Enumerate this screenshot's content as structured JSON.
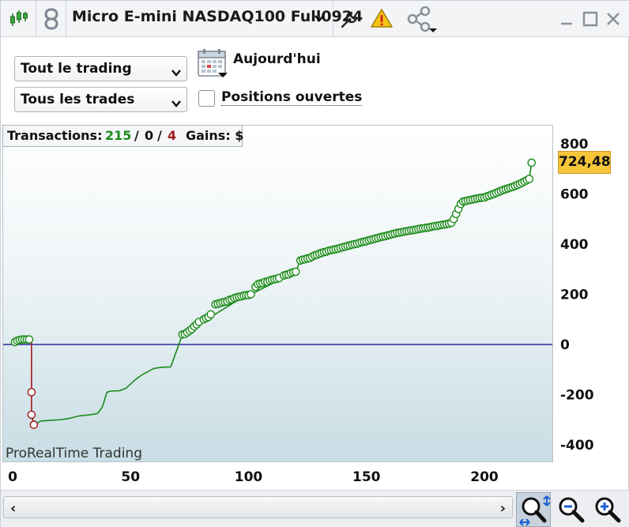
{
  "toolbar": {
    "instrument": "Micro E-mini NASDAQ100 Full0924"
  },
  "filters": {
    "scope_select": "Tout le trading",
    "trades_select": "Tous les trades",
    "date_label": "Aujourd'hui",
    "open_positions_label": "Positions ouvertes",
    "open_positions_checked": false
  },
  "stats": {
    "transactions_label": "Transactions:",
    "winning": "215",
    "separator1": "/",
    "neutral": "0",
    "separator2": "/",
    "losing": "4",
    "gains_label": "Gains: $"
  },
  "watermark": "ProRealTime Trading",
  "last_value": "724,48",
  "colors": {
    "win": "#1a8a1a",
    "loss": "#a01818",
    "zero_line": "#2a2aa0",
    "badge": "#f7c53a"
  },
  "chart_data": {
    "type": "line",
    "title": "",
    "xlabel": "",
    "ylabel": "",
    "xlim": [
      -3,
      232
    ],
    "ylim": [
      -440,
      830
    ],
    "x_ticks": [
      0,
      50,
      100,
      150,
      200
    ],
    "y_ticks": [
      800,
      600,
      400,
      200,
      0,
      -200,
      -400
    ],
    "y_tick_labels": [
      "800",
      "600",
      "400",
      "200",
      "0",
      "-200",
      "-400"
    ],
    "x_tick_labels": [
      "0",
      "50",
      "100",
      "150",
      "200"
    ],
    "grid": false,
    "zero_line": 0,
    "markers_wins": [
      [
        1,
        10
      ],
      [
        2,
        15
      ],
      [
        3,
        18
      ],
      [
        4,
        20
      ],
      [
        5,
        20
      ],
      [
        6,
        20
      ],
      [
        7,
        20
      ],
      [
        72,
        40
      ],
      [
        73,
        42
      ],
      [
        74,
        48
      ],
      [
        75,
        55
      ],
      [
        76,
        62
      ],
      [
        77,
        72
      ],
      [
        78,
        80
      ],
      [
        79,
        90
      ],
      [
        81,
        100
      ],
      [
        82,
        105
      ],
      [
        83,
        110
      ],
      [
        84,
        120
      ],
      [
        86,
        160
      ],
      [
        87,
        162
      ],
      [
        88,
        165
      ],
      [
        89,
        168
      ],
      [
        90,
        170
      ],
      [
        91,
        172
      ],
      [
        92,
        178
      ],
      [
        93,
        180
      ],
      [
        94,
        185
      ],
      [
        95,
        188
      ],
      [
        96,
        190
      ],
      [
        97,
        192
      ],
      [
        98,
        195
      ],
      [
        99,
        197
      ],
      [
        100,
        197
      ],
      [
        101,
        200
      ],
      [
        103,
        230
      ],
      [
        104,
        240
      ],
      [
        105,
        243
      ],
      [
        106,
        245
      ],
      [
        107,
        250
      ],
      [
        108,
        250
      ],
      [
        109,
        255
      ],
      [
        110,
        258
      ],
      [
        111,
        260
      ],
      [
        112,
        262
      ],
      [
        113,
        265
      ],
      [
        115,
        275
      ],
      [
        116,
        278
      ],
      [
        117,
        280
      ],
      [
        118,
        285
      ],
      [
        119,
        288
      ],
      [
        120,
        290
      ],
      [
        122,
        335
      ],
      [
        123,
        338
      ],
      [
        124,
        340
      ],
      [
        125,
        343
      ],
      [
        126,
        345
      ],
      [
        127,
        350
      ],
      [
        128,
        355
      ],
      [
        129,
        358
      ],
      [
        130,
        362
      ],
      [
        131,
        365
      ],
      [
        132,
        368
      ],
      [
        133,
        370
      ],
      [
        134,
        374
      ],
      [
        135,
        376
      ],
      [
        136,
        378
      ],
      [
        137,
        380
      ],
      [
        138,
        382
      ],
      [
        139,
        385
      ],
      [
        140,
        388
      ],
      [
        141,
        390
      ],
      [
        142,
        393
      ],
      [
        143,
        395
      ],
      [
        144,
        398
      ],
      [
        145,
        400
      ],
      [
        146,
        402
      ],
      [
        147,
        405
      ],
      [
        148,
        408
      ],
      [
        149,
        410
      ],
      [
        150,
        412
      ],
      [
        151,
        415
      ],
      [
        152,
        418
      ],
      [
        153,
        420
      ],
      [
        154,
        423
      ],
      [
        155,
        425
      ],
      [
        156,
        428
      ],
      [
        157,
        430
      ],
      [
        158,
        432
      ],
      [
        159,
        435
      ],
      [
        160,
        437
      ],
      [
        161,
        440
      ],
      [
        162,
        442
      ],
      [
        163,
        445
      ],
      [
        164,
        446
      ],
      [
        165,
        448
      ],
      [
        166,
        450
      ],
      [
        167,
        452
      ],
      [
        168,
        453
      ],
      [
        169,
        455
      ],
      [
        170,
        456
      ],
      [
        171,
        458
      ],
      [
        172,
        460
      ],
      [
        173,
        462
      ],
      [
        174,
        463
      ],
      [
        175,
        465
      ],
      [
        176,
        466
      ],
      [
        177,
        468
      ],
      [
        178,
        470
      ],
      [
        179,
        472
      ],
      [
        180,
        473
      ],
      [
        181,
        475
      ],
      [
        182,
        477
      ],
      [
        183,
        478
      ],
      [
        184,
        480
      ],
      [
        185,
        482
      ],
      [
        186,
        485
      ],
      [
        187,
        500
      ],
      [
        188,
        520
      ],
      [
        189,
        540
      ],
      [
        190,
        560
      ],
      [
        191,
        570
      ],
      [
        192,
        572
      ],
      [
        193,
        574
      ],
      [
        194,
        576
      ],
      [
        195,
        578
      ],
      [
        196,
        580
      ],
      [
        197,
        582
      ],
      [
        198,
        584
      ],
      [
        199,
        585
      ],
      [
        200,
        586
      ],
      [
        201,
        590
      ],
      [
        202,
        593
      ],
      [
        203,
        597
      ],
      [
        204,
        600
      ],
      [
        205,
        604
      ],
      [
        206,
        608
      ],
      [
        207,
        612
      ],
      [
        208,
        616
      ],
      [
        209,
        619
      ],
      [
        210,
        622
      ],
      [
        211,
        625
      ],
      [
        212,
        628
      ],
      [
        213,
        632
      ],
      [
        214,
        636
      ],
      [
        215,
        640
      ],
      [
        216,
        645
      ],
      [
        217,
        650
      ],
      [
        218,
        655
      ],
      [
        219,
        660
      ],
      [
        220,
        724.48
      ]
    ],
    "markers_losses": [
      [
        8,
        -190
      ],
      [
        8,
        -280
      ],
      [
        9,
        -320
      ]
    ],
    "equity_line": [
      [
        1,
        10
      ],
      [
        7,
        20
      ],
      [
        8,
        20
      ],
      [
        8,
        -190
      ],
      [
        8,
        -280
      ],
      [
        9,
        -320
      ],
      [
        12,
        -305
      ],
      [
        20,
        -300
      ],
      [
        24,
        -295
      ],
      [
        28,
        -285
      ],
      [
        33,
        -280
      ],
      [
        36,
        -275
      ],
      [
        38,
        -250
      ],
      [
        40,
        -190
      ],
      [
        42,
        -185
      ],
      [
        45,
        -185
      ],
      [
        48,
        -175
      ],
      [
        52,
        -140
      ],
      [
        55,
        -120
      ],
      [
        60,
        -95
      ],
      [
        64,
        -90
      ],
      [
        67,
        -90
      ],
      [
        72,
        40
      ],
      [
        99,
        197
      ],
      [
        101,
        200
      ],
      [
        120,
        290
      ],
      [
        122,
        335
      ],
      [
        186,
        485
      ],
      [
        190,
        560
      ],
      [
        219,
        660
      ],
      [
        220,
        724.48
      ]
    ]
  }
}
